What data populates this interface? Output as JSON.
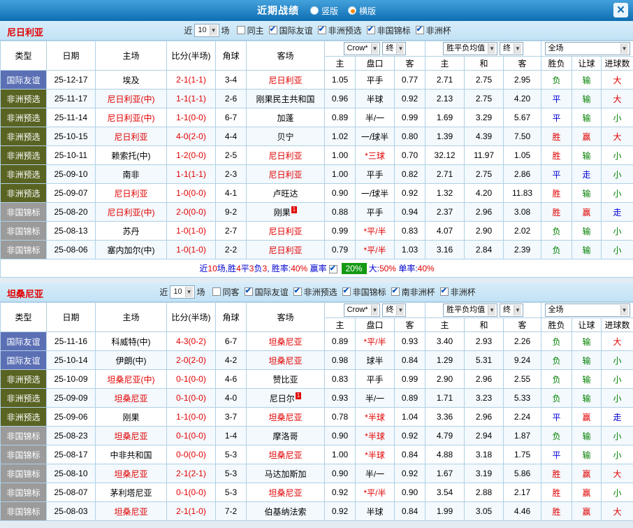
{
  "titlebar": {
    "title": "近期战绩",
    "radios": [
      {
        "label": "竖版",
        "selected": false
      },
      {
        "label": "横版",
        "selected": true
      }
    ],
    "close_icon": "✕"
  },
  "icons": {
    "down": "▼"
  },
  "labels": {
    "near": "近",
    "games": "场"
  },
  "selects": {
    "company": "Crow*",
    "final": "终",
    "avg": "胜平负均值",
    "scope": "全场"
  },
  "base_columns": [
    "类型",
    "日期",
    "主场",
    "比分(半场)",
    "角球",
    "客场"
  ],
  "header_row2": [
    "主",
    "盘口",
    "客",
    "主",
    "和",
    "客",
    "胜负",
    "让球",
    "进球数"
  ],
  "sections": [
    {
      "team": "尼日利亚",
      "filter": {
        "count": "10",
        "same_label": "同主",
        "same_checked": false,
        "comps": [
          "国际友谊",
          "非洲预选",
          "非国锦标",
          "非洲杯"
        ]
      },
      "rows": [
        {
          "type": "国际友谊",
          "date": "25-12-17",
          "home": "埃及",
          "score": "2-1(1-1)",
          "corner": "3-4",
          "away": "尼日利亚",
          "o": [
            "1.05",
            "平手",
            "0.77"
          ],
          "avg": [
            "2.71",
            "2.75",
            "2.95"
          ],
          "res": [
            "负",
            "输",
            "大"
          ]
        },
        {
          "type": "非洲预选",
          "date": "25-11-17",
          "home": "尼日利亚(中)",
          "score": "1-1(1-1)",
          "corner": "2-6",
          "away": "刚果民主共和国",
          "o": [
            "0.96",
            "半球",
            "0.92"
          ],
          "avg": [
            "2.13",
            "2.75",
            "4.20"
          ],
          "res": [
            "平",
            "输",
            "大"
          ]
        },
        {
          "type": "非洲预选",
          "date": "25-11-14",
          "home": "尼日利亚(中)",
          "score": "1-1(0-0)",
          "corner": "6-7",
          "away": "加蓬",
          "o": [
            "0.89",
            "半/一",
            "0.99"
          ],
          "avg": [
            "1.69",
            "3.29",
            "5.67"
          ],
          "res": [
            "平",
            "输",
            "小"
          ]
        },
        {
          "type": "非洲预选",
          "date": "25-10-15",
          "home": "尼日利亚",
          "score": "4-0(2-0)",
          "corner": "4-4",
          "away": "贝宁",
          "o": [
            "1.02",
            "一/球半",
            "0.80"
          ],
          "avg": [
            "1.39",
            "4.39",
            "7.50"
          ],
          "res": [
            "胜",
            "赢",
            "大"
          ]
        },
        {
          "type": "非洲预选",
          "date": "25-10-11",
          "home": "赖索托(中)",
          "score": "1-2(0-0)",
          "corner": "2-5",
          "away": "尼日利亚",
          "o": [
            "1.00",
            "*三球",
            "0.70"
          ],
          "avg": [
            "32.12",
            "11.97",
            "1.05"
          ],
          "res": [
            "胜",
            "输",
            "小"
          ]
        },
        {
          "type": "非洲预选",
          "date": "25-09-10",
          "home": "南非",
          "score": "1-1(1-1)",
          "corner": "2-3",
          "away": "尼日利亚",
          "o": [
            "1.00",
            "平手",
            "0.82"
          ],
          "avg": [
            "2.71",
            "2.75",
            "2.86"
          ],
          "res": [
            "平",
            "走",
            "小"
          ]
        },
        {
          "type": "非洲预选",
          "date": "25-09-07",
          "home": "尼日利亚",
          "score": "1-0(0-0)",
          "corner": "4-1",
          "away": "卢旺达",
          "o": [
            "0.90",
            "一/球半",
            "0.92"
          ],
          "avg": [
            "1.32",
            "4.20",
            "11.83"
          ],
          "res": [
            "胜",
            "输",
            "小"
          ]
        },
        {
          "type": "非国锦标",
          "date": "25-08-20",
          "home": "尼日利亚(中)",
          "score": "2-0(0-0)",
          "corner": "9-2",
          "away": "刚果",
          "away_sup": "1",
          "o": [
            "0.88",
            "平手",
            "0.94"
          ],
          "avg": [
            "2.37",
            "2.96",
            "3.08"
          ],
          "res": [
            "胜",
            "赢",
            "走"
          ]
        },
        {
          "type": "非国锦标",
          "date": "25-08-13",
          "home": "苏丹",
          "score": "1-0(1-0)",
          "corner": "2-7",
          "away": "尼日利亚",
          "o": [
            "0.99",
            "*平/半",
            "0.83"
          ],
          "avg": [
            "4.07",
            "2.90",
            "2.02"
          ],
          "res": [
            "负",
            "输",
            "小"
          ]
        },
        {
          "type": "非国锦标",
          "date": "25-08-06",
          "home": "塞内加尔(中)",
          "score": "1-0(1-0)",
          "corner": "2-2",
          "away": "尼日利亚",
          "o": [
            "0.79",
            "*平/半",
            "1.03"
          ],
          "avg": [
            "3.16",
            "2.84",
            "2.39"
          ],
          "res": [
            "负",
            "输",
            "小"
          ]
        }
      ],
      "summary": [
        {
          "t": "近",
          "c": "b"
        },
        {
          "t": "10",
          "c": "r"
        },
        {
          "t": "场,胜",
          "c": "b"
        },
        {
          "t": "4",
          "c": "r"
        },
        {
          "t": "平",
          "c": "b"
        },
        {
          "t": "3",
          "c": "r"
        },
        {
          "t": "负",
          "c": "b"
        },
        {
          "t": "3",
          "c": "r"
        },
        {
          "t": ", 胜率:",
          "c": "b"
        },
        {
          "t": "40%",
          "c": "r"
        },
        {
          "t": " 赢率",
          "c": "b"
        },
        {
          "cb": true
        },
        {
          "t": "20%",
          "badge": true
        },
        {
          "t": "大:",
          "c": "b"
        },
        {
          "t": "50%",
          "c": "r"
        },
        {
          "t": " 单率:",
          "c": "b"
        },
        {
          "t": "40%",
          "c": "r"
        }
      ]
    },
    {
      "team": "坦桑尼亚",
      "filter": {
        "count": "10",
        "same_label": "同客",
        "same_checked": false,
        "comps": [
          "国际友谊",
          "非洲预选",
          "非国锦标",
          "南非洲杯",
          "非洲杯"
        ]
      },
      "rows": [
        {
          "type": "国际友谊",
          "date": "25-11-16",
          "home": "科威特(中)",
          "score": "4-3(0-2)",
          "corner": "6-7",
          "away": "坦桑尼亚",
          "o": [
            "0.89",
            "*平/半",
            "0.93"
          ],
          "avg": [
            "3.40",
            "2.93",
            "2.26"
          ],
          "res": [
            "负",
            "输",
            "大"
          ]
        },
        {
          "type": "国际友谊",
          "date": "25-10-14",
          "home": "伊朗(中)",
          "score": "2-0(2-0)",
          "corner": "4-2",
          "away": "坦桑尼亚",
          "o": [
            "0.98",
            "球半",
            "0.84"
          ],
          "avg": [
            "1.29",
            "5.31",
            "9.24"
          ],
          "res": [
            "负",
            "输",
            "小"
          ]
        },
        {
          "type": "非洲预选",
          "date": "25-10-09",
          "home": "坦桑尼亚(中)",
          "score": "0-1(0-0)",
          "corner": "4-6",
          "away": "赞比亚",
          "o": [
            "0.83",
            "平手",
            "0.99"
          ],
          "avg": [
            "2.90",
            "2.96",
            "2.55"
          ],
          "res": [
            "负",
            "输",
            "小"
          ]
        },
        {
          "type": "非洲预选",
          "date": "25-09-09",
          "home": "坦桑尼亚",
          "score": "0-1(0-0)",
          "corner": "4-0",
          "away": "尼日尔",
          "away_sup": "1",
          "o": [
            "0.93",
            "半/一",
            "0.89"
          ],
          "avg": [
            "1.71",
            "3.23",
            "5.33"
          ],
          "res": [
            "负",
            "输",
            "小"
          ]
        },
        {
          "type": "非洲预选",
          "date": "25-09-06",
          "home": "刚果",
          "score": "1-1(0-0)",
          "corner": "3-7",
          "away": "坦桑尼亚",
          "o": [
            "0.78",
            "*半球",
            "1.04"
          ],
          "avg": [
            "3.36",
            "2.96",
            "2.24"
          ],
          "res": [
            "平",
            "赢",
            "走"
          ]
        },
        {
          "type": "非国锦标",
          "date": "25-08-23",
          "home": "坦桑尼亚",
          "score": "0-1(0-0)",
          "corner": "1-4",
          "away": "摩洛哥",
          "o": [
            "0.90",
            "*半球",
            "0.92"
          ],
          "avg": [
            "4.79",
            "2.94",
            "1.87"
          ],
          "res": [
            "负",
            "输",
            "小"
          ]
        },
        {
          "type": "非国锦标",
          "date": "25-08-17",
          "home": "中非共和国",
          "score": "0-0(0-0)",
          "corner": "5-3",
          "away": "坦桑尼亚",
          "o": [
            "1.00",
            "*半球",
            "0.84"
          ],
          "avg": [
            "4.88",
            "3.18",
            "1.75"
          ],
          "res": [
            "平",
            "输",
            "小"
          ]
        },
        {
          "type": "非国锦标",
          "date": "25-08-10",
          "home": "坦桑尼亚",
          "score": "2-1(2-1)",
          "corner": "5-3",
          "away": "马达加斯加",
          "o": [
            "0.90",
            "半/一",
            "0.92"
          ],
          "avg": [
            "1.67",
            "3.19",
            "5.86"
          ],
          "res": [
            "胜",
            "赢",
            "大"
          ]
        },
        {
          "type": "非国锦标",
          "date": "25-08-07",
          "home": "茅利塔尼亚",
          "score": "0-1(0-0)",
          "corner": "5-3",
          "away": "坦桑尼亚",
          "o": [
            "0.92",
            "*平/半",
            "0.90"
          ],
          "avg": [
            "3.54",
            "2.88",
            "2.17"
          ],
          "res": [
            "胜",
            "赢",
            "小"
          ]
        },
        {
          "type": "非国锦标",
          "date": "25-08-03",
          "home": "坦桑尼亚",
          "score": "2-1(1-0)",
          "corner": "7-2",
          "away": "伯基纳法索",
          "o": [
            "0.92",
            "半球",
            "0.84"
          ],
          "avg": [
            "1.99",
            "3.05",
            "4.46"
          ],
          "res": [
            "胜",
            "赢",
            "大"
          ]
        }
      ]
    }
  ]
}
